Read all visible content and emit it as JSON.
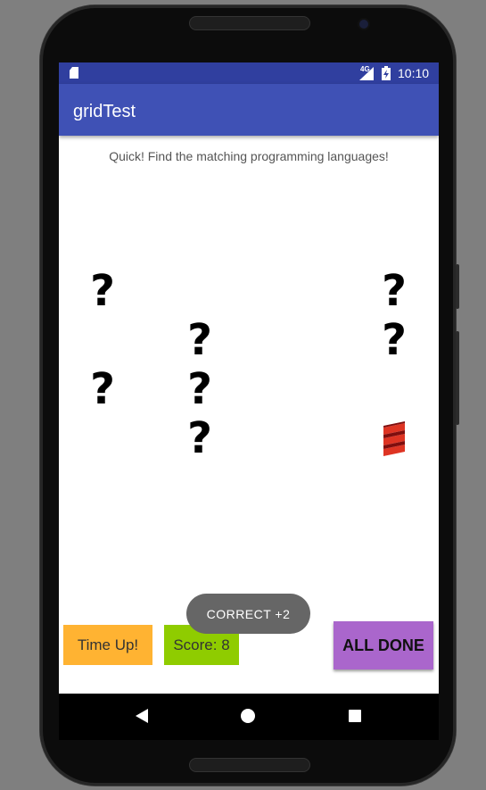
{
  "status_bar": {
    "network": "4G",
    "time": "10:10",
    "icons": [
      "sd-card-icon",
      "signal-icon",
      "battery-charging-icon"
    ]
  },
  "app_bar": {
    "title": "gridTest"
  },
  "prompt": "Quick! Find the matching programming languages!",
  "tiles": [
    {
      "label": "?",
      "state": "hidden"
    },
    {
      "label": "?",
      "state": "hidden"
    },
    {
      "label": "?",
      "state": "hidden"
    },
    {
      "label": "?",
      "state": "hidden"
    },
    {
      "label": "?",
      "state": "hidden"
    },
    {
      "label": "?",
      "state": "hidden"
    },
    {
      "label": "?",
      "state": "hidden"
    },
    {
      "icon": "scala-logo-icon",
      "state": "revealed"
    }
  ],
  "buttons": {
    "time_up": "Time Up!",
    "score": "Score: 8",
    "all_done": "ALL DONE"
  },
  "toast": "CORRECT  +2",
  "colors": {
    "status_bar": "#303f9f",
    "app_bar": "#3f51b5",
    "time_up_button": "#ffb332",
    "score_button": "#8fcc00",
    "all_done_button": "#aa66cc",
    "toast": "#666666",
    "scala_logo": "#de3423"
  },
  "nav_bar": {
    "icons": [
      "back-icon",
      "home-icon",
      "recent-apps-icon"
    ]
  }
}
